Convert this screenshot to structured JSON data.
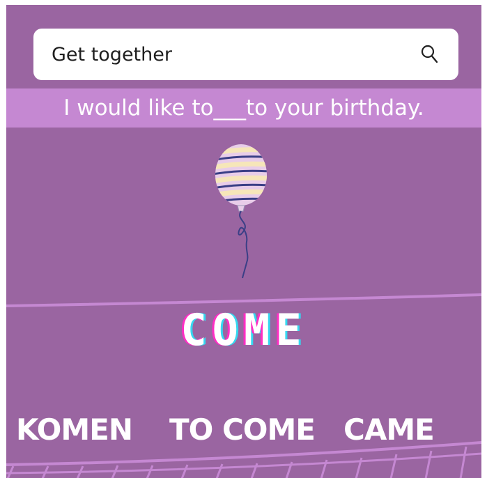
{
  "search": {
    "value": "Get together",
    "icon": "search-icon"
  },
  "question": {
    "sentence": "I would like to___to your birthday."
  },
  "decor": {
    "balloon_icon": "balloon-icon"
  },
  "answer": {
    "word": "COME"
  },
  "options": [
    {
      "label": "KOMEN"
    },
    {
      "label": "TO COME"
    },
    {
      "label": "CAME"
    }
  ],
  "colors": {
    "background": "#9a65a1",
    "band": "#c588d2",
    "glitch_pink": "#ff2ec4",
    "glitch_cyan": "#35d8f0"
  }
}
